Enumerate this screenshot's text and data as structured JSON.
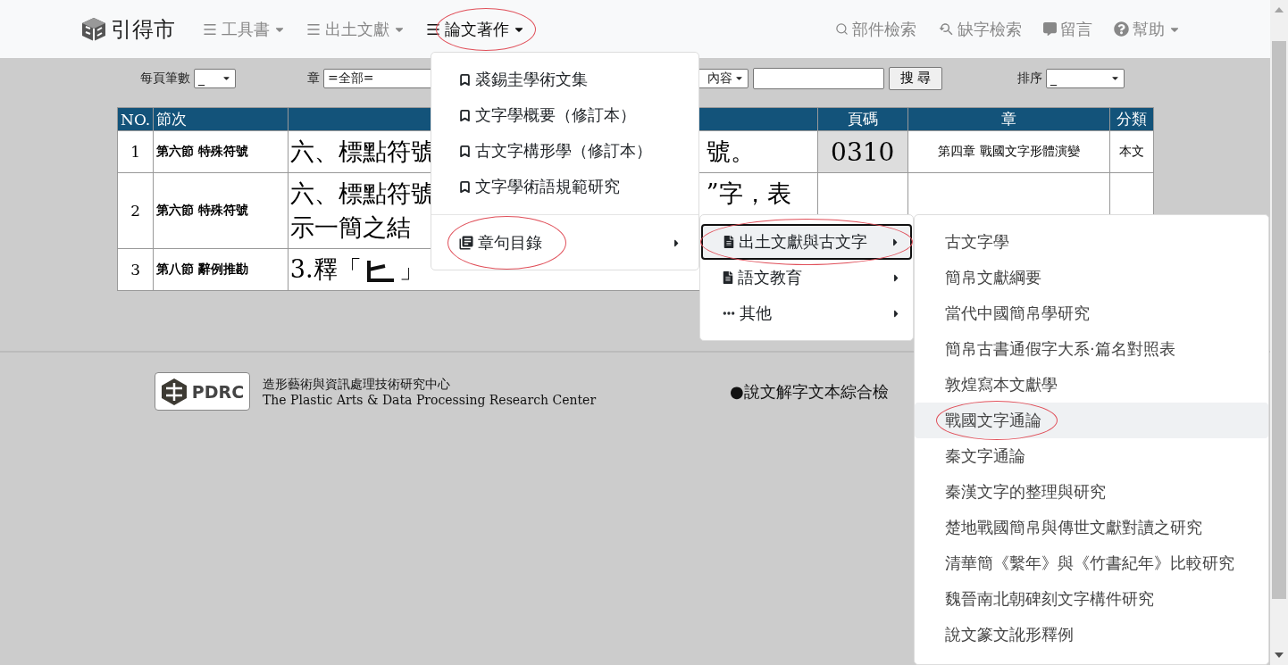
{
  "navbar": {
    "brand": "引得市",
    "items": [
      {
        "label": "工具書",
        "selected": false,
        "circled": false
      },
      {
        "label": "出土文獻",
        "selected": false,
        "circled": false
      },
      {
        "label": "論文著作",
        "selected": true,
        "circled": true
      }
    ],
    "tools": [
      {
        "kind": "search",
        "label": "部件檢索",
        "dropdown": false
      },
      {
        "kind": "lookup",
        "label": "缺字檢索",
        "dropdown": false
      },
      {
        "kind": "message",
        "label": "留言",
        "dropdown": false
      },
      {
        "kind": "help",
        "label": "幫助",
        "dropdown": true
      }
    ]
  },
  "filters": {
    "per_page": {
      "label": "每頁筆數",
      "value": "_"
    },
    "chapter": {
      "label": "章",
      "value": "=全部="
    },
    "field": {
      "value": "內容"
    },
    "search_button": "搜 尋",
    "sort": {
      "label": "排序",
      "value": "_"
    }
  },
  "table": {
    "columns": [
      "NO.",
      "節次",
      "頁碼",
      "章",
      "分類"
    ],
    "rows": [
      {
        "no": "1",
        "section": "第六節 特殊符號",
        "content": [
          {
            "kind": "text",
            "text": "六、標點符號"
          }
        ],
        "content_tail": "號。",
        "page": "0310",
        "chapter": "第四章 戰國文字形體演變",
        "category": "本文"
      },
      {
        "no": "2",
        "section": "第六節 特殊符號",
        "content": [
          {
            "kind": "text",
            "text": "六、標點符號"
          },
          {
            "kind": "break"
          },
          {
            "kind": "text",
            "text": "示一簡之結"
          }
        ],
        "content_tail": "”字，表"
      },
      {
        "no": "3",
        "section": "第八節 辭例推勘",
        "content": [
          {
            "kind": "text",
            "text": "3.釋「"
          },
          {
            "kind": "glyph"
          },
          {
            "kind": "text",
            "text": "」"
          }
        ]
      }
    ]
  },
  "footer": {
    "logo_text": "PDRC",
    "org_zh": "造形藝術與資訊處理技術研究中心",
    "org_en": "The Plastic Arts & Data Processing Research Center",
    "link": "●說文解字文本綜合檢"
  },
  "menu": {
    "items": [
      {
        "kind": "book",
        "label": "裘錫圭學術文集",
        "submenu": false,
        "circled": false
      },
      {
        "kind": "book",
        "label": "文字學概要（修訂本）",
        "submenu": false,
        "circled": false
      },
      {
        "kind": "book",
        "label": "古文字構形學（修訂本）",
        "submenu": false,
        "circled": false
      },
      {
        "kind": "book",
        "label": "文字學術語規範研究",
        "submenu": false,
        "circled": false
      },
      {
        "kind": "divider"
      },
      {
        "kind": "toc",
        "label": "章句目錄",
        "submenu": true,
        "circled": true
      }
    ],
    "submenu": {
      "items": [
        {
          "kind": "doc",
          "label": "出土文獻與古文字",
          "selected": true,
          "circled": true
        },
        {
          "kind": "doc",
          "label": "語文教育",
          "selected": false,
          "circled": false
        },
        {
          "kind": "more",
          "label": "其他",
          "selected": false,
          "circled": false
        }
      ],
      "submenu": {
        "items": [
          {
            "label": "古文字學",
            "selected": false,
            "circled": false
          },
          {
            "label": "簡帛文獻綱要",
            "selected": false,
            "circled": false
          },
          {
            "label": "當代中國簡帛學研究",
            "selected": false,
            "circled": false
          },
          {
            "label": "簡帛古書通假字大系·篇名對照表",
            "selected": false,
            "circled": false
          },
          {
            "label": "敦煌寫本文獻學",
            "selected": false,
            "circled": false
          },
          {
            "label": "戰國文字通論",
            "selected": true,
            "circled": true
          },
          {
            "label": "秦文字通論",
            "selected": false,
            "circled": false
          },
          {
            "label": "秦漢文字的整理與研究",
            "selected": false,
            "circled": false
          },
          {
            "label": "楚地戰國簡帛與傳世文獻對讀之研究",
            "selected": false,
            "circled": false
          },
          {
            "label": "清華簡《繫年》與《竹書紀年》比較研究",
            "selected": false,
            "circled": false
          },
          {
            "label": "魏晉南北朝碑刻文字構件研究",
            "selected": false,
            "circled": false
          },
          {
            "label": "說文篆文訛形釋例",
            "selected": false,
            "circled": false
          }
        ]
      }
    }
  }
}
